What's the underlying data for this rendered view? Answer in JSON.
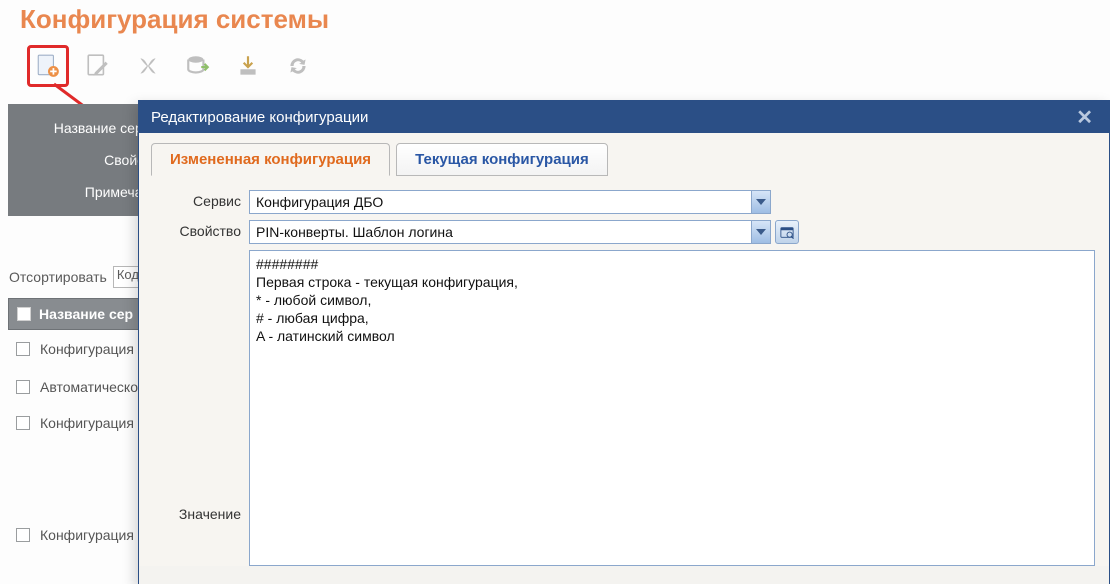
{
  "page": {
    "title": "Конфигурация системы"
  },
  "toolbar": {
    "new": "document-plus-icon",
    "edit": "document-edit-icon",
    "delete": "delete-x-icon",
    "upload": "upload-db-icon",
    "download": "download-icon",
    "refresh": "refresh-icon"
  },
  "bgform": {
    "label_service": "Название серви",
    "label_property": "Свойств",
    "label_note": "Примечани"
  },
  "sort": {
    "label": "Отсортировать",
    "value": "Код"
  },
  "grid": {
    "header": "Название сер",
    "rows": [
      "Конфигурация",
      "Автоматическо",
      "Конфигурация",
      "Конфигурация"
    ]
  },
  "dialog": {
    "title": "Редактирование конфигурации",
    "tabs": {
      "changed": "Измененная конфигурация",
      "current": "Текущая конфигурация"
    },
    "labels": {
      "service": "Сервис",
      "property": "Свойство",
      "value": "Значение"
    },
    "service_value": "Конфигурация ДБО",
    "property_value": "PIN-конверты. Шаблон логина",
    "value_text": "########\nПервая строка - текущая конфигурация,\n* - любой символ,\n# - любая цифра,\nA - латинский символ"
  }
}
